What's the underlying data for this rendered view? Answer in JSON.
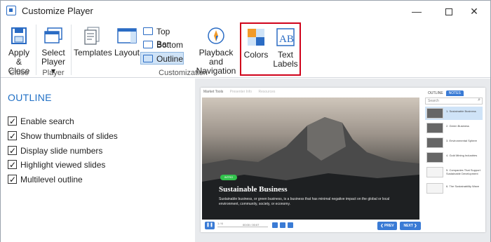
{
  "window": {
    "title": "Customize Player",
    "minimize": "—",
    "close": "✕"
  },
  "ribbon": {
    "apply_close": {
      "line1": "Apply",
      "line2": "& Close"
    },
    "select_player": {
      "line1": "Select",
      "line2": "Player ▾"
    },
    "templates": "Templates",
    "layout": "Layout",
    "top_bar": "Top Bar",
    "bottom_bar": "Bottom Bar",
    "outline": "Outline",
    "playback": {
      "line1": "Playback and",
      "line2": "Navigation"
    },
    "colors": "Colors",
    "text_labels": {
      "line1": "Text",
      "line2": "Labels"
    },
    "groups": {
      "close": "Close",
      "player": "Player",
      "customization": "Customization"
    },
    "accent_color": "#2b6cc4",
    "highlight_color": "#d0021b"
  },
  "outline_panel": {
    "heading": "OUTLINE",
    "options": [
      {
        "label": "Enable search",
        "checked": true
      },
      {
        "label": "Show thumbnails of slides",
        "checked": true
      },
      {
        "label": "Display slide numbers",
        "checked": true
      },
      {
        "label": "Highlight viewed slides",
        "checked": true
      },
      {
        "label": "Multilevel outline",
        "checked": true
      }
    ]
  },
  "preview": {
    "tabs": [
      "Market Tools",
      "Presenter Info",
      "Resources"
    ],
    "slide": {
      "badge": "INTRO",
      "title": "Sustainable Business",
      "text": "Sustainable business, or green business, is a business that has minimal negative impact on the global or local environment, community, society, or economy."
    },
    "controls": {
      "slide_count": "1 / 6",
      "time": "00:00 / 00:07",
      "prev": "❮ PREV",
      "next": "NEXT ❯"
    },
    "sidebar": {
      "tab_outline": "OUTLINE",
      "tab_notes": "NOTES",
      "search_placeholder": "Search",
      "items": [
        "1. Sustainable Business",
        "2. Green Business",
        "3. Environmental Sphere",
        "4. Gold Mining Industries",
        "5. Companies That Support Sustainable Development",
        "6. The Sustainability Wave"
      ]
    }
  }
}
